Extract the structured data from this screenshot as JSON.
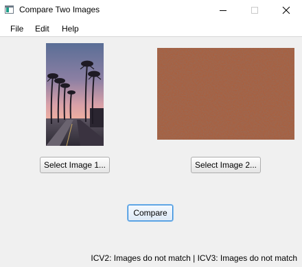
{
  "window": {
    "title": "Compare Two Images"
  },
  "menu": {
    "items": [
      {
        "label": "File"
      },
      {
        "label": "Edit"
      },
      {
        "label": "Help"
      }
    ]
  },
  "images": {
    "image1": {
      "content": "palm-trees-sunset-road-photo"
    },
    "image2": {
      "content": "red-dirt-soil-texture-photo"
    }
  },
  "buttons": {
    "select1_label": "Select Image 1...",
    "select2_label": "Select Image 2...",
    "compare_label": "Compare"
  },
  "status": {
    "text": "ICV2: Images do not match | ICV3: Images do not match"
  },
  "colors": {
    "focus_accent": "#2b86d9"
  }
}
